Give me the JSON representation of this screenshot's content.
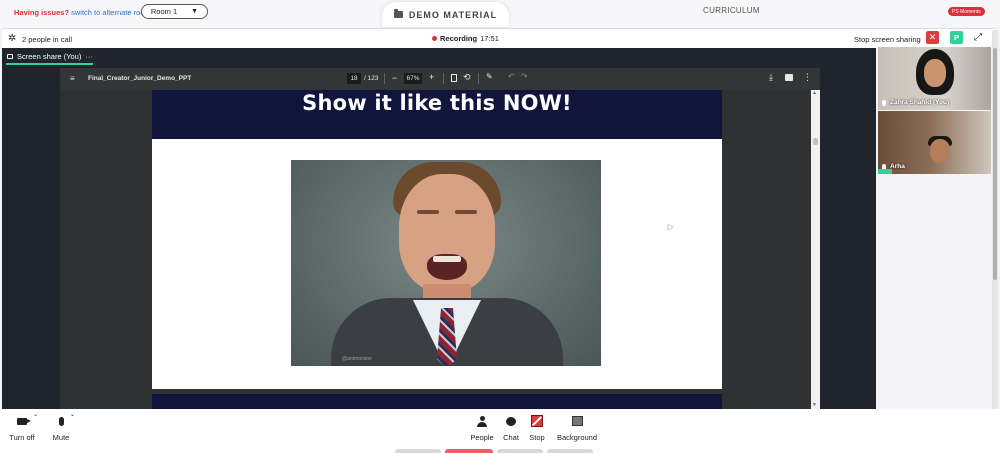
{
  "topbar": {
    "issues_label": "Having issues?",
    "issues_link": "switch to alternate room",
    "room_label": "Room 1",
    "room_arrow": "▼",
    "demo_material": "DEMO MATERIAL",
    "curriculum": "CURRICULUM",
    "moments_badge": "PS Moments"
  },
  "callbar": {
    "gear_icon": "✲",
    "people_count": "2 people in call",
    "recording_label": "Recording",
    "recording_time": "17:51",
    "stop_sharing": "Stop screen sharing",
    "close_glyph": "✕",
    "participant_initial": "P",
    "expand_glyph": "⤢"
  },
  "share": {
    "tab_label": "Screen share (You)",
    "tab_more": "···"
  },
  "pdf": {
    "menu_glyph": "≡",
    "file_name": "Final_Creator_Junior_Demo_PPT",
    "current_page": "18",
    "total_pages": "/ 123",
    "minus_glyph": "−",
    "zoom": "67%",
    "plus_glyph": "+",
    "rotate_glyph": "⟲",
    "pen_glyph": "✎",
    "undo_glyph": "↶",
    "redo_glyph": "↷",
    "download_glyph": "⤓",
    "more_glyph": "⋮"
  },
  "slide": {
    "title": "Show it like this NOW!",
    "gif_watermark": "@antmonster"
  },
  "videos": [
    {
      "name": "Zahra Shahid (You)"
    },
    {
      "name": "Arha"
    }
  ],
  "controls": {
    "turn_off": "Turn off",
    "mute": "Mute",
    "people": "People",
    "chat": "Chat",
    "stop": "Stop",
    "background": "Background",
    "caret_glyph": "⌄"
  },
  "colors": {
    "accent": "#2fd39a",
    "danger": "#e03b3b",
    "slide_navy": "#11153b"
  }
}
